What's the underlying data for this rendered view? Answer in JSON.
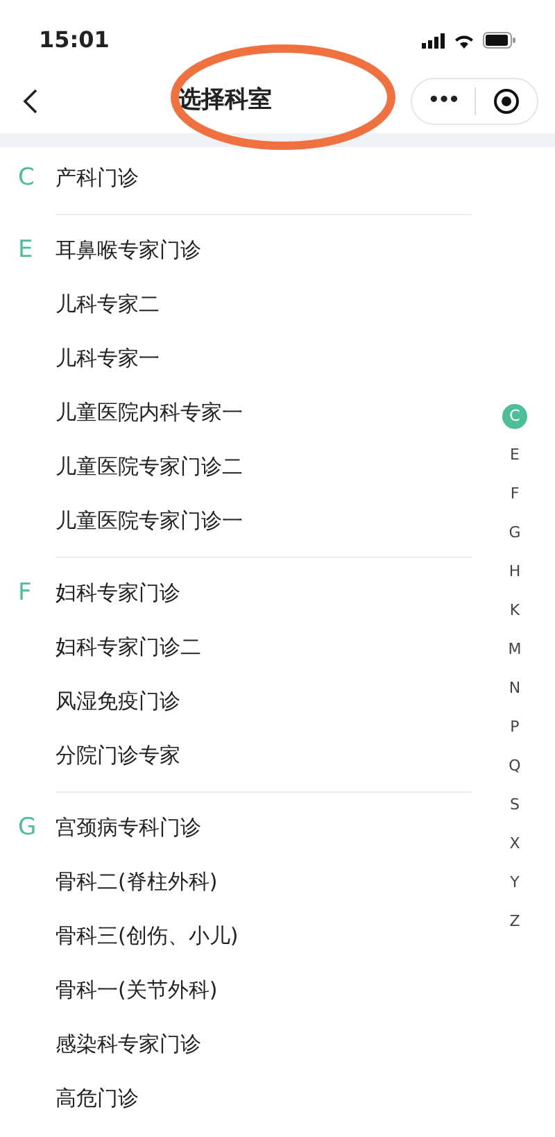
{
  "status_bar": {
    "time": "15:01"
  },
  "nav": {
    "title": "选择科室",
    "more": "•••",
    "highlighted": true
  },
  "groups": [
    {
      "letter": "C",
      "items": [
        "产科门诊"
      ]
    },
    {
      "letter": "E",
      "items": [
        "耳鼻喉专家门诊",
        "儿科专家二",
        "儿科专家一",
        "儿童医院内科专家一",
        "儿童医院专家门诊二",
        "儿童医院专家门诊一"
      ]
    },
    {
      "letter": "F",
      "items": [
        "妇科专家门诊",
        "妇科专家门诊二",
        "风湿免疫门诊",
        "分院门诊专家"
      ]
    },
    {
      "letter": "G",
      "items": [
        "宫颈病专科门诊",
        "骨科二(脊柱外科)",
        "骨科三(创伤、小儿)",
        "骨科一(关节外科)",
        "感染科专家门诊",
        "高危门诊"
      ]
    }
  ],
  "index": [
    {
      "letter": "C",
      "selected": true
    },
    {
      "letter": "E",
      "selected": false
    },
    {
      "letter": "F",
      "selected": false
    },
    {
      "letter": "G",
      "selected": false
    },
    {
      "letter": "H",
      "selected": false
    },
    {
      "letter": "K",
      "selected": false
    },
    {
      "letter": "M",
      "selected": false
    },
    {
      "letter": "N",
      "selected": false
    },
    {
      "letter": "P",
      "selected": false
    },
    {
      "letter": "Q",
      "selected": false
    },
    {
      "letter": "S",
      "selected": false
    },
    {
      "letter": "X",
      "selected": false
    },
    {
      "letter": "Y",
      "selected": false
    },
    {
      "letter": "Z",
      "selected": false
    }
  ]
}
